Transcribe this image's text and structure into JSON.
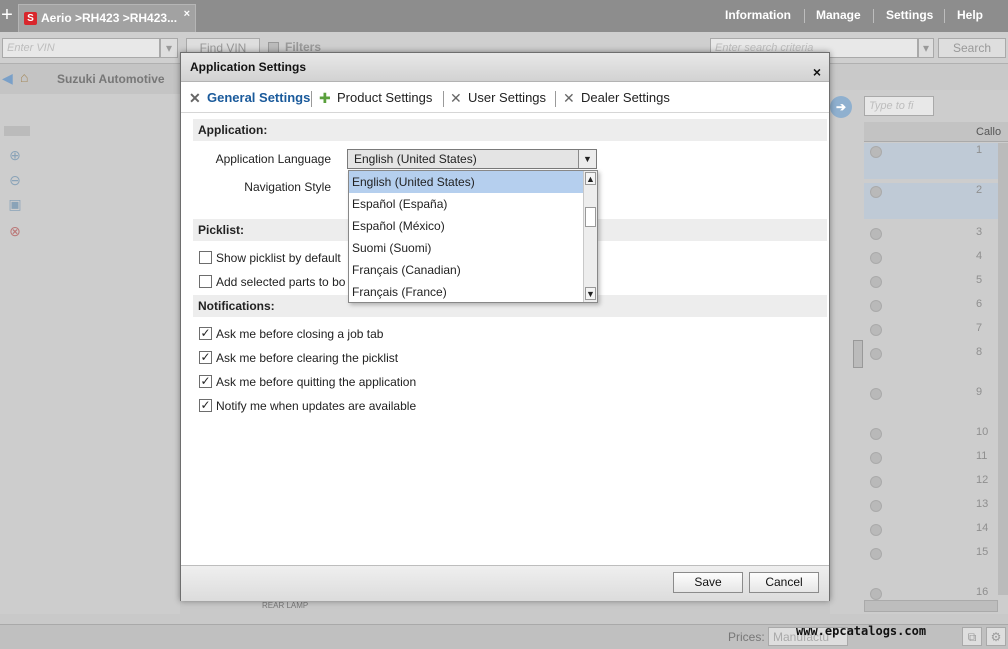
{
  "topbar": {
    "job_tab": "Aerio >RH423 >RH423...",
    "nav": [
      "Information",
      "Manage",
      "Settings",
      "Help"
    ]
  },
  "toolbar": {
    "vin_placeholder": "Enter VIN",
    "find_vin": "Find VIN",
    "filters": "Filters",
    "search_placeholder": "Enter search criteria",
    "search": "Search"
  },
  "breadcrumb": {
    "label": "Suzuki Automotive"
  },
  "right_panel": {
    "filter_placeholder": "Type to fi",
    "col_header": "Callo",
    "rows": [
      "1",
      "2",
      "3",
      "4",
      "5",
      "6",
      "7",
      "8",
      "9",
      "10",
      "11",
      "12",
      "13",
      "14",
      "15",
      "16"
    ]
  },
  "bottom": {
    "prices": "Prices:",
    "prices_value": "Manufactu",
    "rear_lamp": "REAR LAMP"
  },
  "watermark": "www.epcatalogs.com",
  "dialog": {
    "title": "Application Settings",
    "close": "×",
    "tabs": [
      "General Settings",
      "Product Settings",
      "User Settings",
      "Dealer Settings"
    ],
    "application": {
      "heading": "Application:",
      "language_label": "Application Language",
      "language_value": "English (United States)",
      "navstyle_label": "Navigation Style",
      "language_options": [
        "English (United States)",
        "Español (España)",
        "Español (México)",
        "Suomi (Suomi)",
        "Français (Canadian)",
        "Français (France)"
      ]
    },
    "picklist": {
      "heading": "Picklist:",
      "items": [
        {
          "label": "Show picklist by default",
          "checked": false
        },
        {
          "label": "Add selected parts to bo",
          "checked": false
        }
      ]
    },
    "notifications": {
      "heading": "Notifications:",
      "items": [
        {
          "label": "Ask me before closing a job tab",
          "checked": true
        },
        {
          "label": "Ask me before clearing the picklist",
          "checked": true
        },
        {
          "label": "Ask me before quitting the application",
          "checked": true
        },
        {
          "label": "Notify me when updates are available",
          "checked": true
        }
      ]
    },
    "buttons": {
      "save": "Save",
      "cancel": "Cancel"
    }
  }
}
